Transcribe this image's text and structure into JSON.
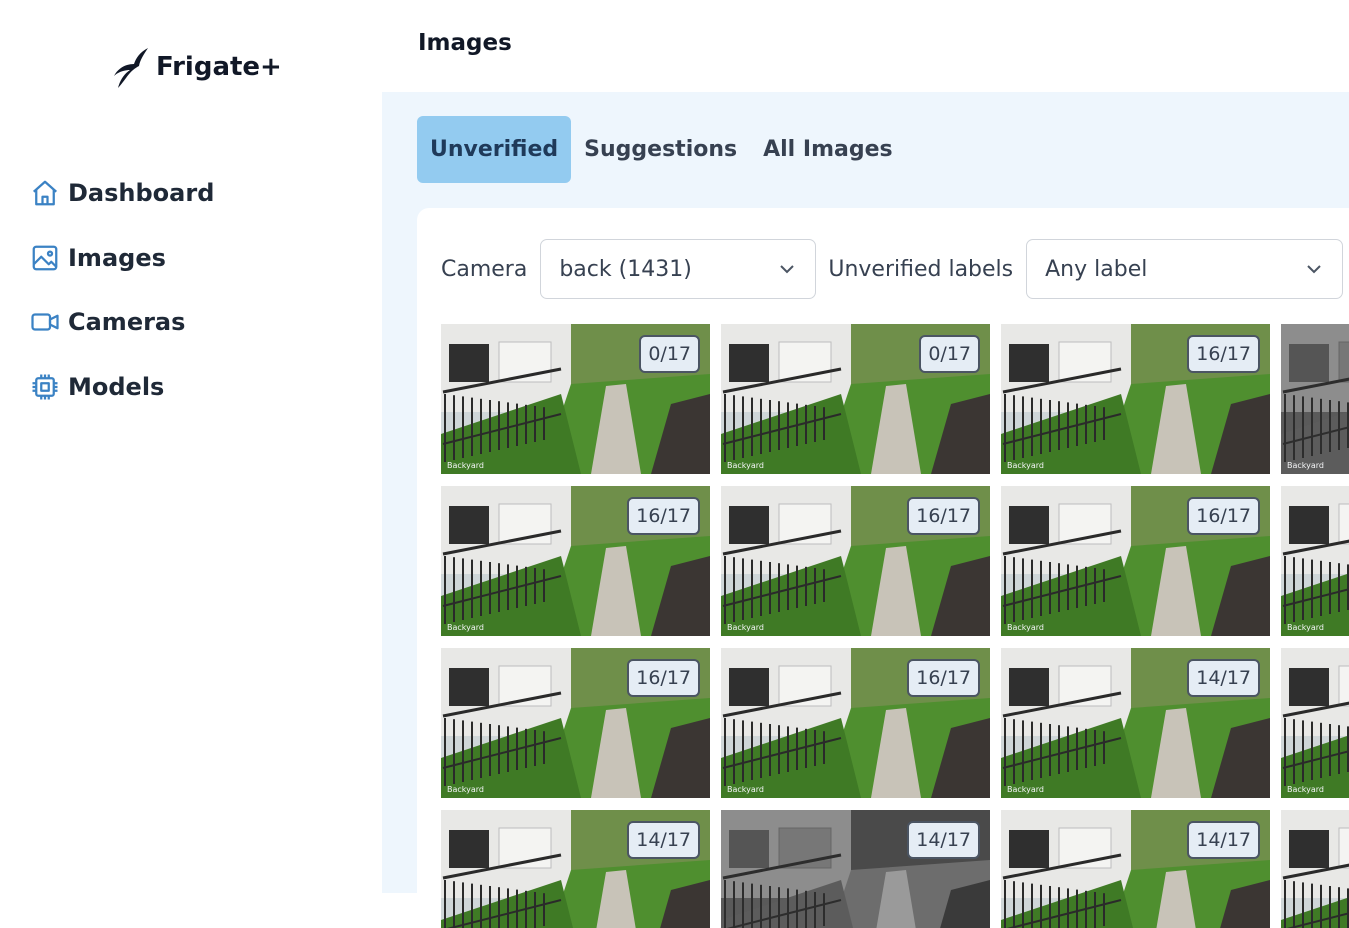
{
  "app": {
    "name": "Frigate+"
  },
  "nav": {
    "items": [
      {
        "label": "Dashboard",
        "icon": "home-icon"
      },
      {
        "label": "Images",
        "icon": "image-icon"
      },
      {
        "label": "Cameras",
        "icon": "video-icon"
      },
      {
        "label": "Models",
        "icon": "chip-icon"
      }
    ]
  },
  "header": {
    "title": "Images"
  },
  "tabs": [
    {
      "label": "Unverified",
      "active": true
    },
    {
      "label": "Suggestions",
      "active": false
    },
    {
      "label": "All Images",
      "active": false
    }
  ],
  "filters": {
    "camera_label": "Camera",
    "camera_value": "back (1431)",
    "labels_label": "Unverified labels",
    "labels_value": "Any label"
  },
  "thumbnails": [
    {
      "count": "0/17",
      "caption": "Backyard",
      "night": false
    },
    {
      "count": "0/17",
      "caption": "Backyard",
      "night": false
    },
    {
      "count": "16/17",
      "caption": "Backyard",
      "night": false
    },
    {
      "count": "",
      "caption": "Backyard",
      "night": true
    },
    {
      "count": "16/17",
      "caption": "Backyard",
      "night": false
    },
    {
      "count": "16/17",
      "caption": "Backyard",
      "night": false
    },
    {
      "count": "16/17",
      "caption": "Backyard",
      "night": false
    },
    {
      "count": "",
      "caption": "Backyard",
      "night": false
    },
    {
      "count": "16/17",
      "caption": "Backyard",
      "night": false
    },
    {
      "count": "16/17",
      "caption": "Backyard",
      "night": false
    },
    {
      "count": "14/17",
      "caption": "Backyard",
      "night": false
    },
    {
      "count": "",
      "caption": "Backyard",
      "night": false
    },
    {
      "count": "14/17",
      "caption": "",
      "night": false
    },
    {
      "count": "14/17",
      "caption": "",
      "night": true
    },
    {
      "count": "14/17",
      "caption": "",
      "night": false
    },
    {
      "count": "",
      "caption": "",
      "night": false
    }
  ],
  "colors": {
    "accent_tab": "#93cbf0",
    "panel_bg": "#eef6fd",
    "icon_blue": "#3b82c4"
  }
}
